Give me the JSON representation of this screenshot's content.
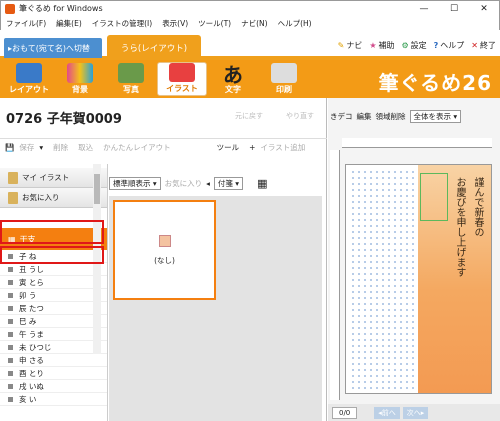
{
  "window": {
    "title": "筆ぐるめ for Windows"
  },
  "menu": [
    "ファイル(F)",
    "編集(E)",
    "イラストの管理(I)",
    "表示(V)",
    "ツール(T)",
    "ナビ(N)",
    "ヘルプ(H)"
  ],
  "tabs": {
    "omote": "▸おもて(宛て名)へ切替",
    "ura": "うら(レイアウト)"
  },
  "toplinks": {
    "navi": "ナビ",
    "hojo": "補助",
    "settei": "設定",
    "help": "ヘルプ",
    "end": "終了"
  },
  "ribbon": {
    "items": [
      "レイアウト",
      "背景",
      "写真",
      "イラスト",
      "文字",
      "印刷"
    ],
    "active": "イラスト",
    "brand": "筆ぐるめ26"
  },
  "doc": {
    "title": "0726 子年賀0009",
    "undo": "元に戻す",
    "redo": "やり直す"
  },
  "toolbar": {
    "save": "保存",
    "delete": "削除",
    "import": "取込",
    "easy": "かんたんレイアウト",
    "tool": "ツール",
    "add": "イラスト追加"
  },
  "categories": {
    "my": "マイ イラスト",
    "fav": "お気に入り",
    "selected": "干支",
    "items": [
      "子 ね",
      "丑 うし",
      "寅 とら",
      "卯 う",
      "辰 たつ",
      "巳 み",
      "午 うま",
      "未 ひつじ",
      "申 さる",
      "酉 とり",
      "戌 いぬ",
      "亥 い"
    ]
  },
  "gallery": {
    "sort": "標準順表示",
    "fav": "お気に入り",
    "attach": "付箋",
    "card_label": "(なし)"
  },
  "preview": {
    "tools": [
      "きデコ",
      "編集",
      "領域削除"
    ],
    "select": "全体を表示",
    "text1": "謹んで新春の",
    "text2": "お慶びを申し上げます",
    "page": "0/0",
    "prev": "前へ",
    "next": "次へ"
  },
  "colors": {
    "accent": "#f39b16",
    "selection": "#f47f10",
    "highlight": "#e01818"
  }
}
